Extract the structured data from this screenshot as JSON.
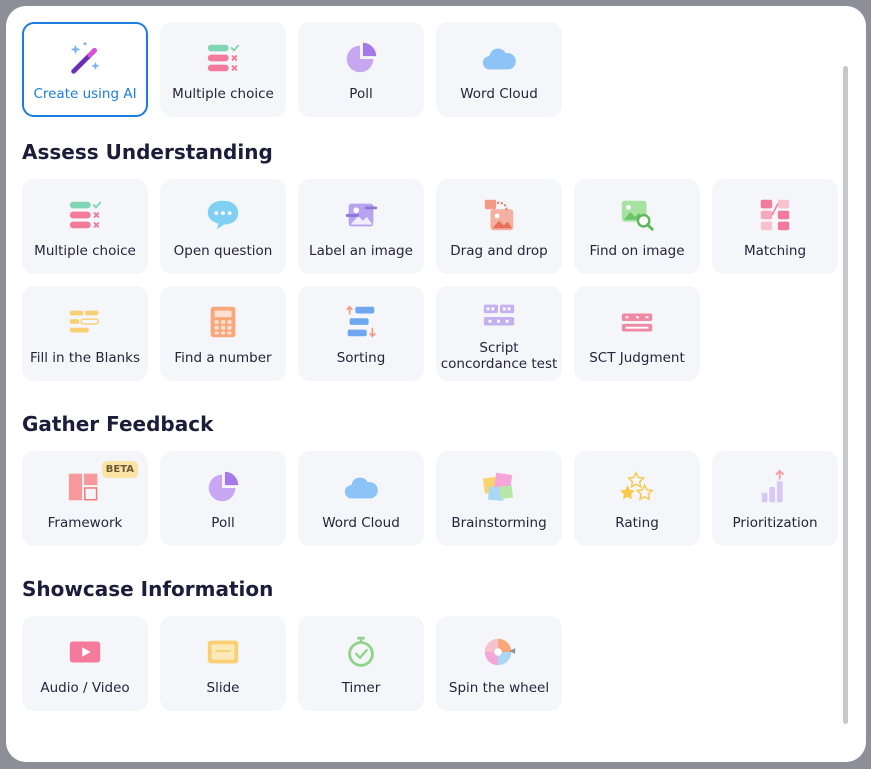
{
  "top_row": [
    {
      "name": "create-using-ai",
      "label": "Create using AI",
      "icon": "magic-wand-icon",
      "selected": true
    },
    {
      "name": "multiple-choice",
      "label": "Multiple choice",
      "icon": "multiple-choice-icon"
    },
    {
      "name": "poll",
      "label": "Poll",
      "icon": "pie-chart-icon"
    },
    {
      "name": "word-cloud",
      "label": "Word Cloud",
      "icon": "cloud-icon"
    }
  ],
  "sections": {
    "assess": {
      "title": "Assess Understanding",
      "items": [
        {
          "label": "Multiple choice",
          "icon": "multiple-choice-icon"
        },
        {
          "label": "Open question",
          "icon": "speech-bubble-icon"
        },
        {
          "label": "Label an image",
          "icon": "label-image-icon"
        },
        {
          "label": "Drag and drop",
          "icon": "drag-drop-icon"
        },
        {
          "label": "Find on image",
          "icon": "find-image-icon"
        },
        {
          "label": "Matching",
          "icon": "matching-icon"
        },
        {
          "label": "Fill in the Blanks",
          "icon": "fill-blanks-icon"
        },
        {
          "label": "Find a number",
          "icon": "calculator-icon"
        },
        {
          "label": "Sorting",
          "icon": "sorting-icon"
        },
        {
          "label": "Script concordance test",
          "icon": "script-concordance-icon"
        },
        {
          "label": "SCT Judgment",
          "icon": "sct-judgment-icon"
        }
      ]
    },
    "feedback": {
      "title": "Gather Feedback",
      "items": [
        {
          "label": "Framework",
          "icon": "framework-icon",
          "badge": "BETA"
        },
        {
          "label": "Poll",
          "icon": "pie-chart-icon"
        },
        {
          "label": "Word Cloud",
          "icon": "cloud-icon"
        },
        {
          "label": "Brainstorming",
          "icon": "sticky-notes-icon"
        },
        {
          "label": "Rating",
          "icon": "stars-icon"
        },
        {
          "label": "Prioritization",
          "icon": "bar-growth-icon"
        }
      ]
    },
    "showcase": {
      "title": "Showcase Information",
      "items": [
        {
          "label": "Audio / Video",
          "icon": "play-video-icon"
        },
        {
          "label": "Slide",
          "icon": "slide-icon"
        },
        {
          "label": "Timer",
          "icon": "stopwatch-icon"
        },
        {
          "label": "Spin the wheel",
          "icon": "wheel-icon"
        }
      ]
    }
  },
  "colors": {
    "accent": "#1c7de0",
    "tile_bg": "#f5f6fa",
    "title": "#1b1d3a"
  }
}
